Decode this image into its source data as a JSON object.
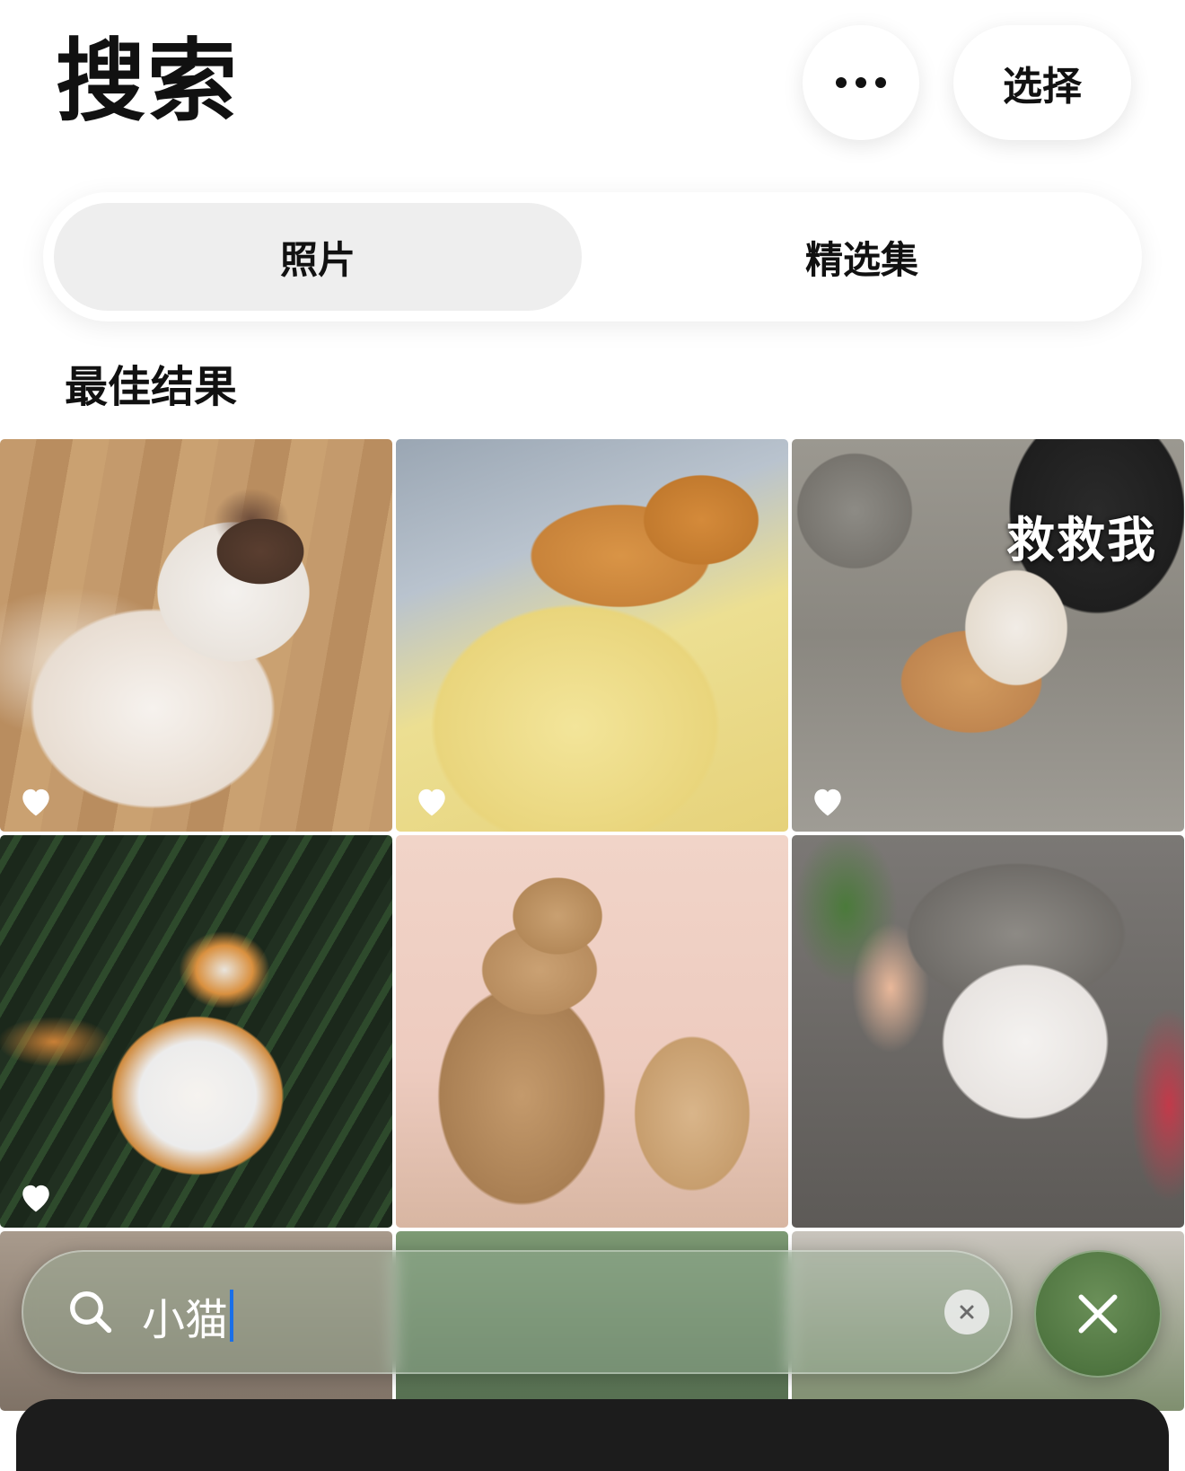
{
  "header": {
    "title": "搜索",
    "more_icon": "ellipsis-icon",
    "select_label": "选择"
  },
  "tabs": [
    {
      "label": "照片",
      "selected": true
    },
    {
      "label": "精选集",
      "selected": false
    }
  ],
  "section": {
    "title": "最佳结果"
  },
  "results": [
    {
      "favorite": true,
      "overlay_text": ""
    },
    {
      "favorite": true,
      "overlay_text": ""
    },
    {
      "favorite": true,
      "overlay_text": "救救我"
    },
    {
      "favorite": true,
      "overlay_text": ""
    },
    {
      "favorite": false,
      "overlay_text": ""
    },
    {
      "favorite": false,
      "overlay_text": ""
    }
  ],
  "search": {
    "icon": "search-icon",
    "query": "小猫",
    "clear_icon": "clear-circle-icon",
    "cancel_icon": "close-icon"
  },
  "colors": {
    "caret": "#1a6fe8",
    "segment_selected_bg": "#eeeeee",
    "search_bar_tint": "#96af96"
  }
}
